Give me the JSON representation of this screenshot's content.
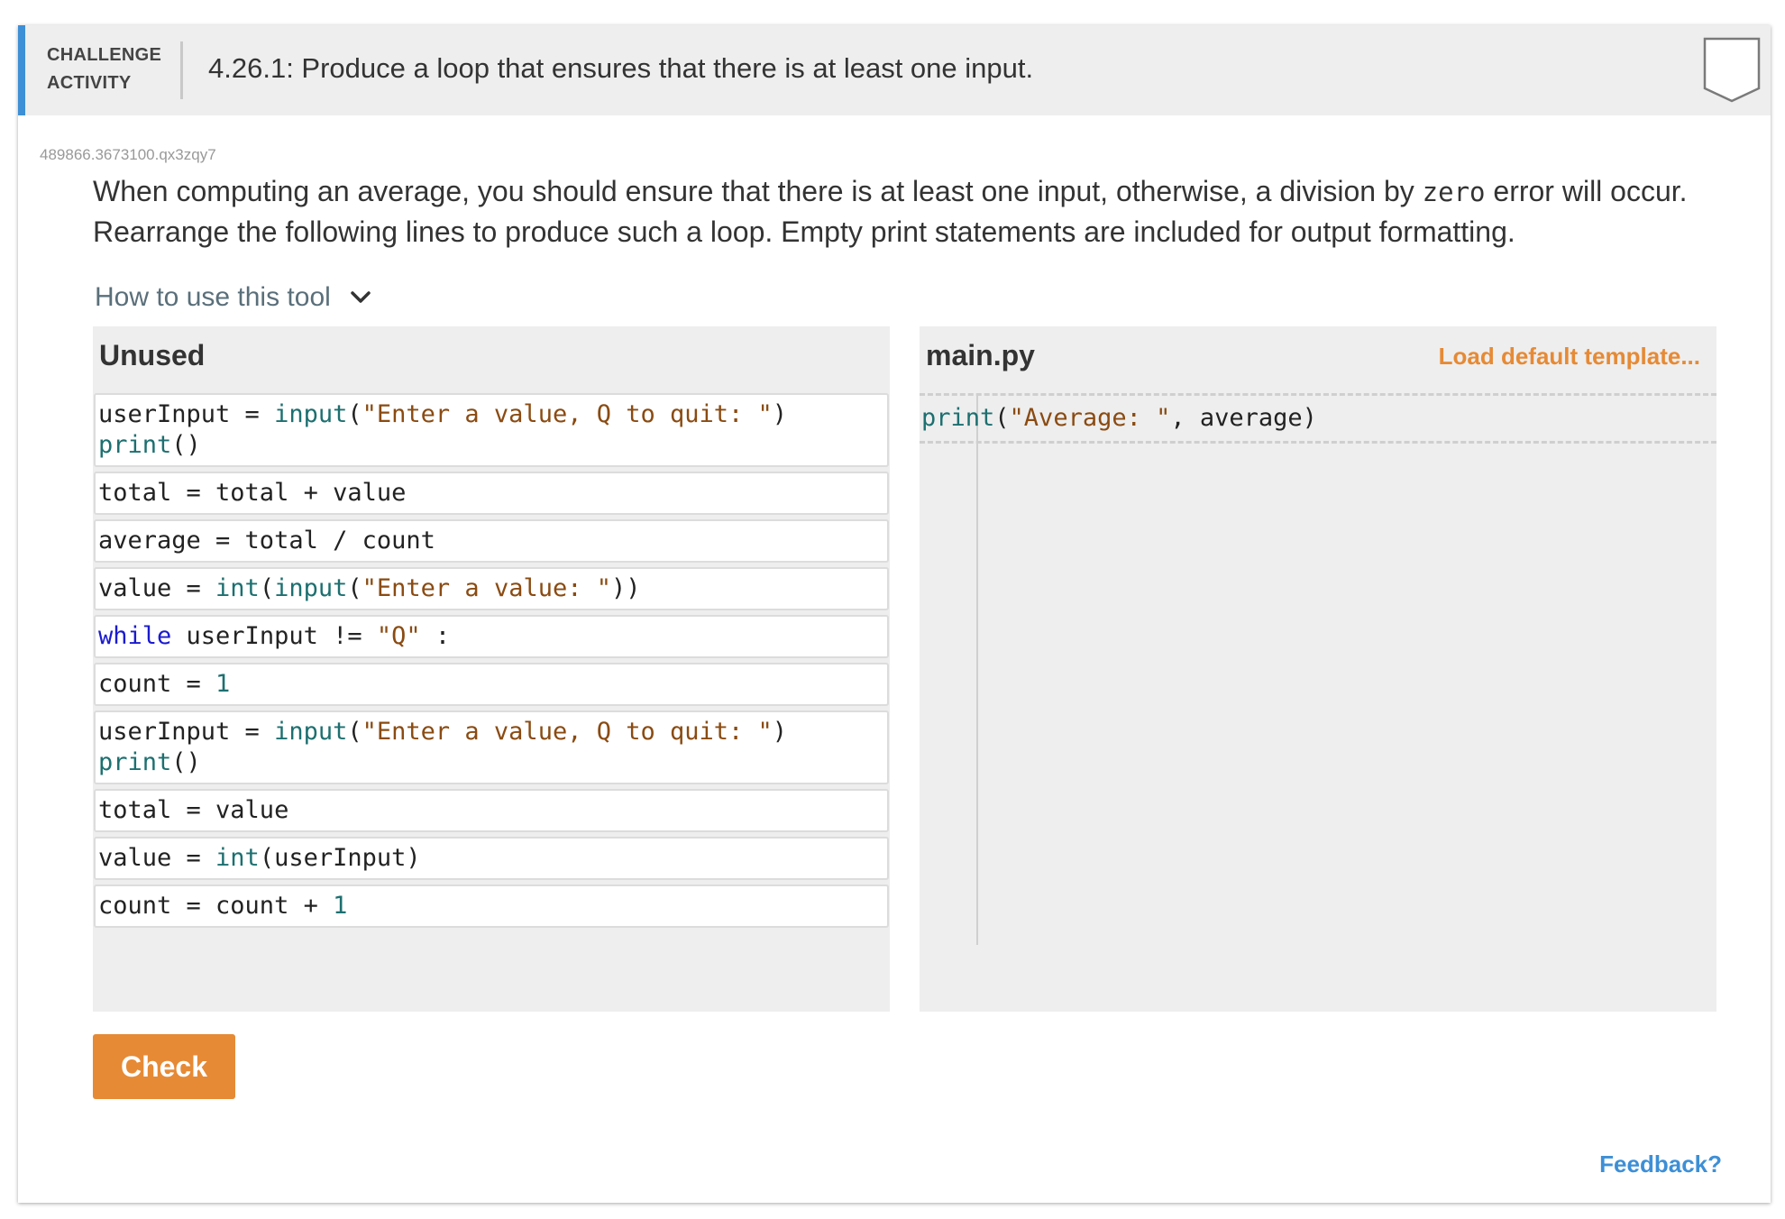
{
  "header": {
    "activity_label_line1": "CHALLENGE",
    "activity_label_line2": "ACTIVITY",
    "title": "4.26.1: Produce a loop that ensures that there is at least one input."
  },
  "activity_id": "489866.3673100.qx3zqy7",
  "description": {
    "before_code": "When computing an average, you should ensure that there is at least one input, otherwise, a division by ",
    "code_word": "zero",
    "after_code": " error will occur. Rearrange the following lines to produce such a loop. Empty print statements are included for output formatting."
  },
  "how_to": {
    "label": "How to use this tool"
  },
  "unused_panel": {
    "title": "Unused",
    "blocks": [
      {
        "lines": [
          [
            {
              "t": "userInput = ",
              "c": "op"
            },
            {
              "t": "input",
              "c": "fn"
            },
            {
              "t": "(",
              "c": "op"
            },
            {
              "t": "\"Enter a value, Q to quit: \"",
              "c": "str"
            },
            {
              "t": ")",
              "c": "op"
            }
          ],
          [
            {
              "t": "print",
              "c": "fn"
            },
            {
              "t": "()",
              "c": "op"
            }
          ]
        ]
      },
      {
        "lines": [
          [
            {
              "t": "total = total + value",
              "c": "op"
            }
          ]
        ]
      },
      {
        "lines": [
          [
            {
              "t": "average = total / count",
              "c": "op"
            }
          ]
        ]
      },
      {
        "lines": [
          [
            {
              "t": "value = ",
              "c": "op"
            },
            {
              "t": "int",
              "c": "fn"
            },
            {
              "t": "(",
              "c": "op"
            },
            {
              "t": "input",
              "c": "fn"
            },
            {
              "t": "(",
              "c": "op"
            },
            {
              "t": "\"Enter a value: \"",
              "c": "str"
            },
            {
              "t": "))",
              "c": "op"
            }
          ]
        ]
      },
      {
        "lines": [
          [
            {
              "t": "while",
              "c": "kw"
            },
            {
              "t": " userInput != ",
              "c": "op"
            },
            {
              "t": "\"Q\"",
              "c": "str"
            },
            {
              "t": " :",
              "c": "op"
            }
          ]
        ]
      },
      {
        "lines": [
          [
            {
              "t": "count = ",
              "c": "op"
            },
            {
              "t": "1",
              "c": "num"
            }
          ]
        ]
      },
      {
        "lines": [
          [
            {
              "t": "userInput = ",
              "c": "op"
            },
            {
              "t": "input",
              "c": "fn"
            },
            {
              "t": "(",
              "c": "op"
            },
            {
              "t": "\"Enter a value, Q to quit: \"",
              "c": "str"
            },
            {
              "t": ")",
              "c": "op"
            }
          ],
          [
            {
              "t": "print",
              "c": "fn"
            },
            {
              "t": "()",
              "c": "op"
            }
          ]
        ]
      },
      {
        "lines": [
          [
            {
              "t": "total = value",
              "c": "op"
            }
          ]
        ]
      },
      {
        "lines": [
          [
            {
              "t": "value = ",
              "c": "op"
            },
            {
              "t": "int",
              "c": "fn"
            },
            {
              "t": "(userInput)",
              "c": "op"
            }
          ]
        ]
      },
      {
        "lines": [
          [
            {
              "t": "count = count + ",
              "c": "op"
            },
            {
              "t": "1",
              "c": "num"
            }
          ]
        ]
      }
    ]
  },
  "main_panel": {
    "title": "main.py",
    "load_template_label": "Load default template...",
    "lines": [
      [
        {
          "t": "print",
          "c": "fn"
        },
        {
          "t": "(",
          "c": "op"
        },
        {
          "t": "\"Average: \"",
          "c": "str"
        },
        {
          "t": ", average)",
          "c": "op"
        }
      ]
    ]
  },
  "check_button": {
    "label": "Check"
  },
  "feedback": {
    "label": "Feedback?"
  },
  "colors": {
    "accent_blue": "#3d8fd6",
    "accent_orange": "#e68a35",
    "panel_bg": "#eeeeee"
  }
}
